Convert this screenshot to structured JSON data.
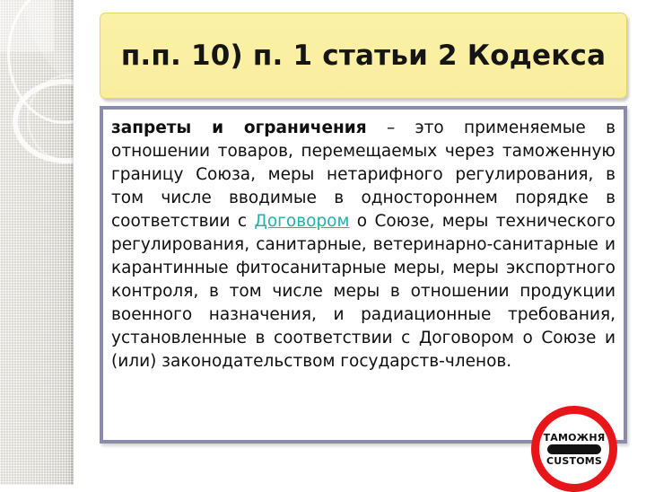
{
  "slide": {
    "title": "п.п. 10) п. 1 статьи 2 Кодекса",
    "body": {
      "lead_bold": "запреты и ограничения",
      "part1": " – это применяемые в отношении товаров, перемещаемых через таможенную границу Союза, меры нетарифного регулирования, в том числе вводимые в одностороннем порядке в соответствии с ",
      "link": "Договором",
      "part2": " о Союзе, меры технического регулирования, санитарные, ветеринарно-санитарные и карантинные фитосанитарные меры, меры экспортного контроля, в том числе меры в отношении продукции военного назначения, и радиационные требования, установленные в соответствии с Договором о Союзе и (или) законодательством государств-членов."
    }
  },
  "badge": {
    "top_label": "ТАМОЖНЯ",
    "bottom_label": "CUSTOMS"
  },
  "colors": {
    "title_bg": "#fbf1a6",
    "title_border": "#e3d46a",
    "content_border": "#8b8bac",
    "link": "#24b0ad",
    "badge_red": "#e8151b",
    "sidebar_gray": "#d8d5cf"
  }
}
